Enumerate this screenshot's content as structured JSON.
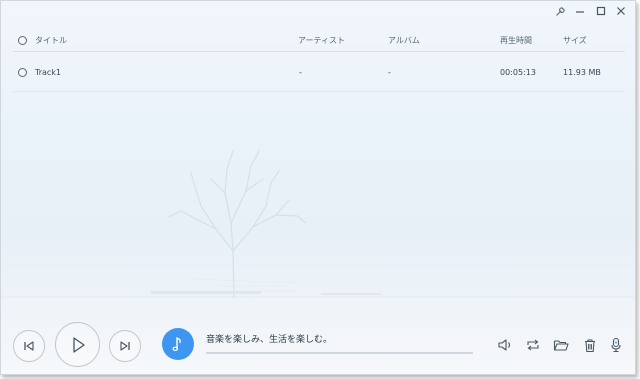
{
  "window": {
    "controls": [
      {
        "name": "settings",
        "icon": "wrench-icon"
      },
      {
        "name": "minimize",
        "icon": "minimize-icon"
      },
      {
        "name": "maximize",
        "icon": "maximize-icon"
      },
      {
        "name": "close",
        "icon": "close-icon"
      }
    ]
  },
  "list": {
    "columns": {
      "title": "タイトル",
      "artist": "アーティスト",
      "album": "アルバム",
      "duration": "再生時間",
      "size": "サイズ"
    },
    "rows": [
      {
        "title": "Track1",
        "artist": "-",
        "album": "-",
        "duration": "00:05:13",
        "size": "11.93 MB"
      }
    ]
  },
  "player": {
    "now_playing": "音楽を楽しみ、生活を楽しむ。",
    "progress": 0,
    "accent_color": "#3e96f0",
    "buttons": [
      "previous",
      "play",
      "next",
      "volume",
      "repeat",
      "open-folder",
      "delete",
      "microphone"
    ]
  }
}
